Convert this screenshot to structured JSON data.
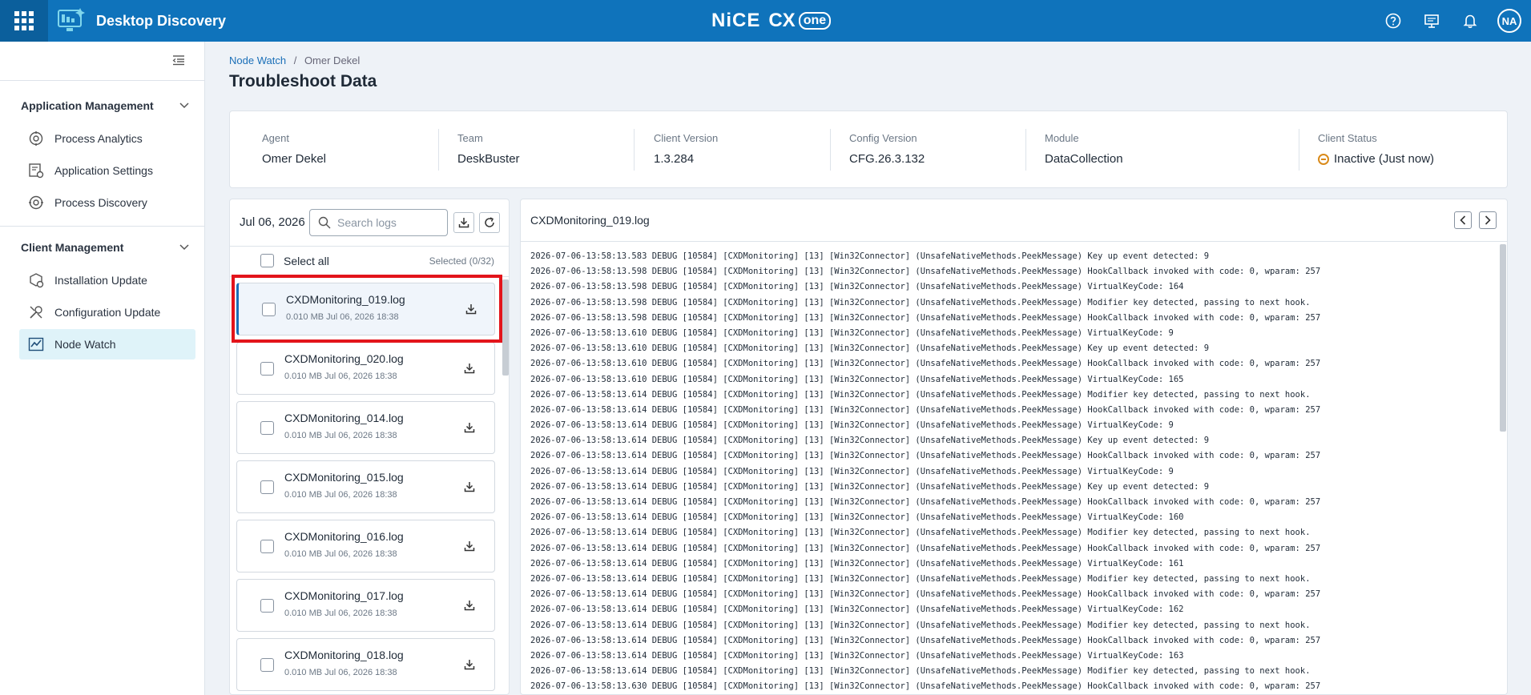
{
  "topbar": {
    "app_title": "Desktop Discovery",
    "brand_nice": "NiCE",
    "brand_cx": "CX",
    "brand_one": "one",
    "avatar_initials": "NA",
    "icons": [
      "apps-grid-icon",
      "desktop-discovery-logo-icon",
      "help-icon",
      "whats-new-icon",
      "notifications-bell-icon"
    ]
  },
  "sidebar": {
    "sections": [
      {
        "title": "Application Management",
        "items": [
          {
            "label": "Process Analytics",
            "icon": "process-analytics-icon"
          },
          {
            "label": "Application Settings",
            "icon": "application-settings-icon"
          },
          {
            "label": "Process Discovery",
            "icon": "process-discovery-icon"
          }
        ]
      },
      {
        "title": "Client Management",
        "items": [
          {
            "label": "Installation Update",
            "icon": "installation-update-icon"
          },
          {
            "label": "Configuration Update",
            "icon": "configuration-update-icon"
          },
          {
            "label": "Node Watch",
            "icon": "node-watch-icon",
            "active": true
          }
        ]
      }
    ]
  },
  "breadcrumb": {
    "parent": "Node Watch",
    "separator": "/",
    "current": "Omer Dekel"
  },
  "page_title": "Troubleshoot Data",
  "info": {
    "agent": {
      "label": "Agent",
      "value": "Omer Dekel"
    },
    "team": {
      "label": "Team",
      "value": "DeskBuster"
    },
    "client_version": {
      "label": "Client Version",
      "value": "1.3.284"
    },
    "config_version": {
      "label": "Config Version",
      "value": "CFG.26.3.132"
    },
    "module": {
      "label": "Module",
      "value": "DataCollection"
    },
    "client_status": {
      "label": "Client Status",
      "value": "Inactive (Just now)",
      "color": "#d98a1a"
    }
  },
  "log_list": {
    "date": "Jul 06, 2026",
    "search_placeholder": "Search logs",
    "select_all_label": "Select all",
    "selected_count": "Selected (0/32)",
    "files": [
      {
        "name": "CXDMonitoring_019.log",
        "meta": "0.010 MB Jul 06, 2026 18:38",
        "selected": true
      },
      {
        "name": "CXDMonitoring_020.log",
        "meta": "0.010 MB Jul 06, 2026 18:38"
      },
      {
        "name": "CXDMonitoring_014.log",
        "meta": "0.010 MB Jul 06, 2026 18:38"
      },
      {
        "name": "CXDMonitoring_015.log",
        "meta": "0.010 MB Jul 06, 2026 18:38"
      },
      {
        "name": "CXDMonitoring_016.log",
        "meta": "0.010 MB Jul 06, 2026 18:38"
      },
      {
        "name": "CXDMonitoring_017.log",
        "meta": "0.010 MB Jul 06, 2026 18:38"
      },
      {
        "name": "CXDMonitoring_018.log",
        "meta": "0.010 MB Jul 06, 2026 18:38"
      }
    ]
  },
  "viewer": {
    "title": "CXDMonitoring_019.log",
    "lines": [
      "2026-07-06-13:58:13.583 DEBUG [10584] [CXDMonitoring] [13] [Win32Connector] (UnsafeNativeMethods.PeekMessage) Key up event detected: 9",
      "2026-07-06-13:58:13.598 DEBUG [10584] [CXDMonitoring] [13] [Win32Connector] (UnsafeNativeMethods.PeekMessage) HookCallback invoked with code: 0, wparam: 257",
      "2026-07-06-13:58:13.598 DEBUG [10584] [CXDMonitoring] [13] [Win32Connector] (UnsafeNativeMethods.PeekMessage) VirtualKeyCode: 164",
      "2026-07-06-13:58:13.598 DEBUG [10584] [CXDMonitoring] [13] [Win32Connector] (UnsafeNativeMethods.PeekMessage) Modifier key detected, passing to next hook.",
      "2026-07-06-13:58:13.598 DEBUG [10584] [CXDMonitoring] [13] [Win32Connector] (UnsafeNativeMethods.PeekMessage) HookCallback invoked with code: 0, wparam: 257",
      "2026-07-06-13:58:13.610 DEBUG [10584] [CXDMonitoring] [13] [Win32Connector] (UnsafeNativeMethods.PeekMessage) VirtualKeyCode: 9",
      "2026-07-06-13:58:13.610 DEBUG [10584] [CXDMonitoring] [13] [Win32Connector] (UnsafeNativeMethods.PeekMessage) Key up event detected: 9",
      "2026-07-06-13:58:13.610 DEBUG [10584] [CXDMonitoring] [13] [Win32Connector] (UnsafeNativeMethods.PeekMessage) HookCallback invoked with code: 0, wparam: 257",
      "2026-07-06-13:58:13.610 DEBUG [10584] [CXDMonitoring] [13] [Win32Connector] (UnsafeNativeMethods.PeekMessage) VirtualKeyCode: 165",
      "2026-07-06-13:58:13.614 DEBUG [10584] [CXDMonitoring] [13] [Win32Connector] (UnsafeNativeMethods.PeekMessage) Modifier key detected, passing to next hook.",
      "2026-07-06-13:58:13.614 DEBUG [10584] [CXDMonitoring] [13] [Win32Connector] (UnsafeNativeMethods.PeekMessage) HookCallback invoked with code: 0, wparam: 257",
      "2026-07-06-13:58:13.614 DEBUG [10584] [CXDMonitoring] [13] [Win32Connector] (UnsafeNativeMethods.PeekMessage) VirtualKeyCode: 9",
      "2026-07-06-13:58:13.614 DEBUG [10584] [CXDMonitoring] [13] [Win32Connector] (UnsafeNativeMethods.PeekMessage) Key up event detected: 9",
      "2026-07-06-13:58:13.614 DEBUG [10584] [CXDMonitoring] [13] [Win32Connector] (UnsafeNativeMethods.PeekMessage) HookCallback invoked with code: 0, wparam: 257",
      "2026-07-06-13:58:13.614 DEBUG [10584] [CXDMonitoring] [13] [Win32Connector] (UnsafeNativeMethods.PeekMessage) VirtualKeyCode: 9",
      "2026-07-06-13:58:13.614 DEBUG [10584] [CXDMonitoring] [13] [Win32Connector] (UnsafeNativeMethods.PeekMessage) Key up event detected: 9",
      "2026-07-06-13:58:13.614 DEBUG [10584] [CXDMonitoring] [13] [Win32Connector] (UnsafeNativeMethods.PeekMessage) HookCallback invoked with code: 0, wparam: 257",
      "2026-07-06-13:58:13.614 DEBUG [10584] [CXDMonitoring] [13] [Win32Connector] (UnsafeNativeMethods.PeekMessage) VirtualKeyCode: 160",
      "2026-07-06-13:58:13.614 DEBUG [10584] [CXDMonitoring] [13] [Win32Connector] (UnsafeNativeMethods.PeekMessage) Modifier key detected, passing to next hook.",
      "2026-07-06-13:58:13.614 DEBUG [10584] [CXDMonitoring] [13] [Win32Connector] (UnsafeNativeMethods.PeekMessage) HookCallback invoked with code: 0, wparam: 257",
      "2026-07-06-13:58:13.614 DEBUG [10584] [CXDMonitoring] [13] [Win32Connector] (UnsafeNativeMethods.PeekMessage) VirtualKeyCode: 161",
      "2026-07-06-13:58:13.614 DEBUG [10584] [CXDMonitoring] [13] [Win32Connector] (UnsafeNativeMethods.PeekMessage) Modifier key detected, passing to next hook.",
      "2026-07-06-13:58:13.614 DEBUG [10584] [CXDMonitoring] [13] [Win32Connector] (UnsafeNativeMethods.PeekMessage) HookCallback invoked with code: 0, wparam: 257",
      "2026-07-06-13:58:13.614 DEBUG [10584] [CXDMonitoring] [13] [Win32Connector] (UnsafeNativeMethods.PeekMessage) VirtualKeyCode: 162",
      "2026-07-06-13:58:13.614 DEBUG [10584] [CXDMonitoring] [13] [Win32Connector] (UnsafeNativeMethods.PeekMessage) Modifier key detected, passing to next hook.",
      "2026-07-06-13:58:13.614 DEBUG [10584] [CXDMonitoring] [13] [Win32Connector] (UnsafeNativeMethods.PeekMessage) HookCallback invoked with code: 0, wparam: 257",
      "2026-07-06-13:58:13.614 DEBUG [10584] [CXDMonitoring] [13] [Win32Connector] (UnsafeNativeMethods.PeekMessage) VirtualKeyCode: 163",
      "2026-07-06-13:58:13.614 DEBUG [10584] [CXDMonitoring] [13] [Win32Connector] (UnsafeNativeMethods.PeekMessage) Modifier key detected, passing to next hook.",
      "2026-07-06-13:58:13.630 DEBUG [10584] [CXDMonitoring] [13] [Win32Connector] (UnsafeNativeMethods.PeekMessage) HookCallback invoked with code: 0, wparam: 257"
    ]
  },
  "colors": {
    "topbar": "#0f73bb",
    "accent": "#1a6fb8",
    "highlight": "#e3141b",
    "active_nav": "#dff3f9"
  }
}
